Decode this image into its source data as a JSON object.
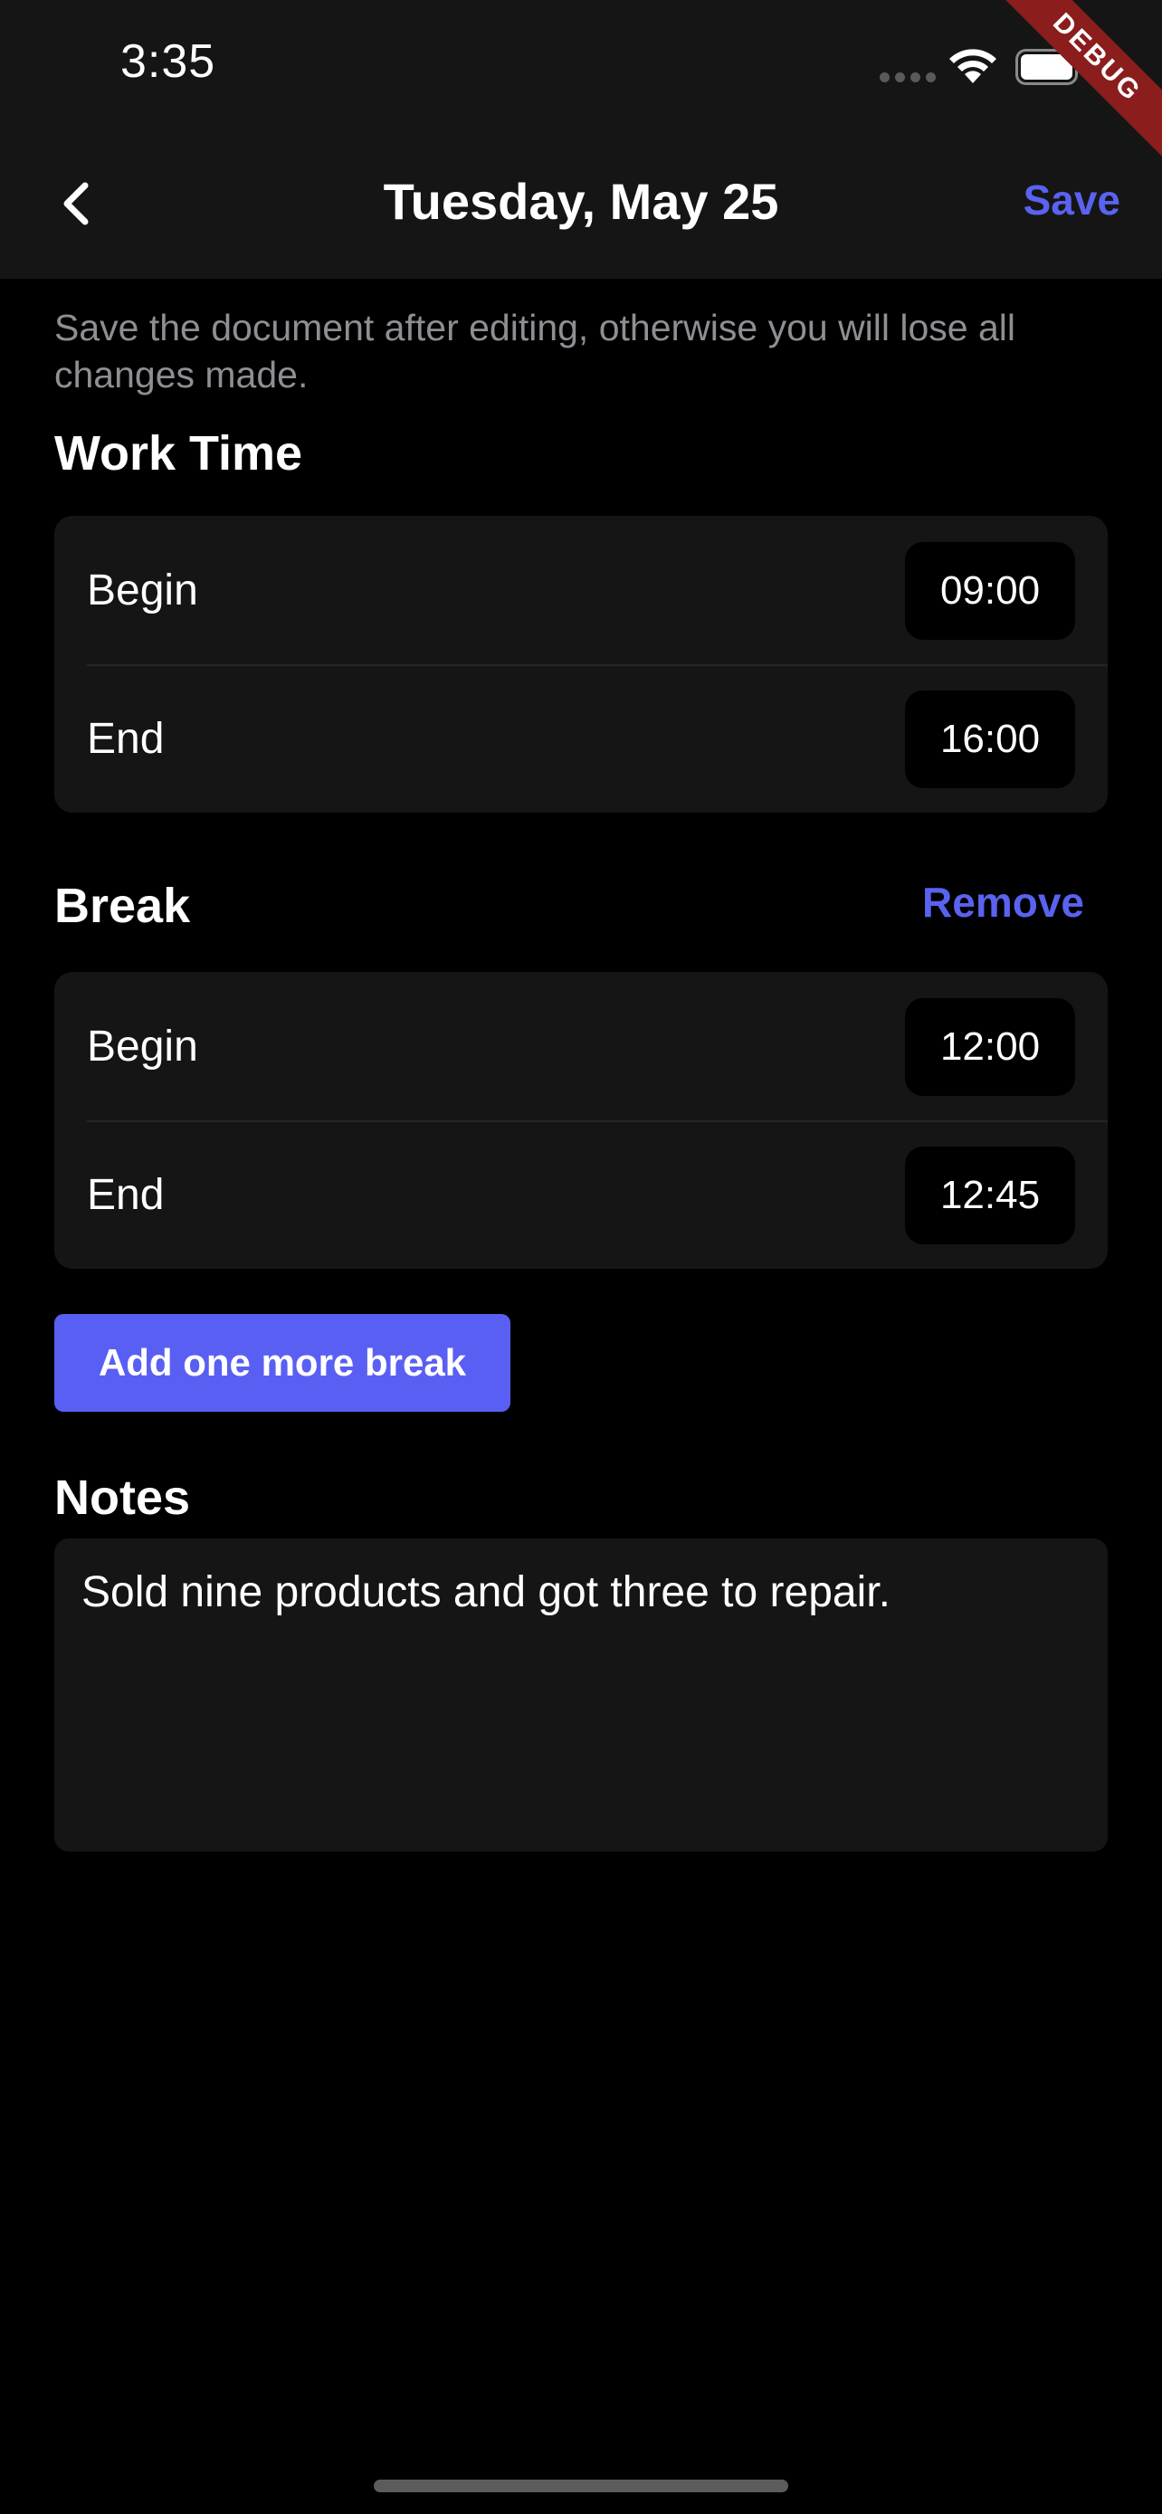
{
  "status_bar": {
    "time": "3:35",
    "debug_label": "DEBUG"
  },
  "nav": {
    "title": "Tuesday, May 25",
    "save_label": "Save"
  },
  "hint_text": "Save the document after editing, otherwise you will lose all changes made.",
  "work_time": {
    "title": "Work Time",
    "begin_label": "Begin",
    "begin_value": "09:00",
    "end_label": "End",
    "end_value": "16:00"
  },
  "break": {
    "title": "Break",
    "remove_label": "Remove",
    "begin_label": "Begin",
    "begin_value": "12:00",
    "end_label": "End",
    "end_value": "12:45"
  },
  "add_break_label": "Add one more break",
  "notes": {
    "title": "Notes",
    "value": "Sold nine products and got three to repair."
  },
  "colors": {
    "accent": "#5a62f0",
    "background": "#000000",
    "card": "#151515",
    "debug_ribbon": "#8b1d1d"
  },
  "icons": {
    "back": "chevron-left-icon",
    "wifi": "wifi-icon",
    "battery": "battery-icon",
    "signal": "signal-dots-icon"
  }
}
